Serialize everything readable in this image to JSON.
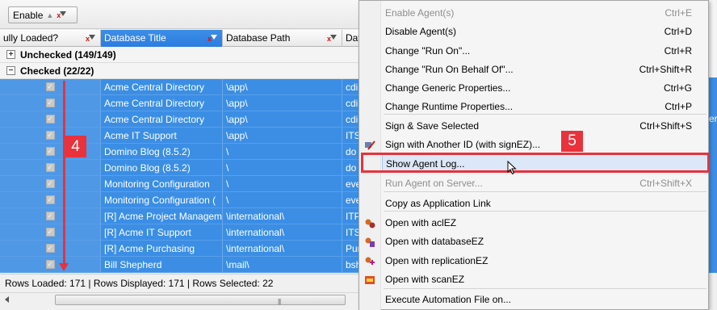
{
  "toolbar": {
    "enable_label": "Enable"
  },
  "grid": {
    "columns": [
      "ully Loaded?",
      "Database Title",
      "Database Path",
      "Dat"
    ],
    "groups": [
      {
        "expander": "+",
        "label": "Unchecked (149/149)"
      },
      {
        "expander": "−",
        "label": "Checked (22/22)"
      }
    ],
    "rows": [
      {
        "title": "Acme Central Directory",
        "path": "\\app\\",
        "extra": "cdi"
      },
      {
        "title": "Acme Central Directory",
        "path": "\\app\\",
        "extra": "cdi"
      },
      {
        "title": "Acme Central Directory",
        "path": "\\app\\",
        "extra": "cdi"
      },
      {
        "title": "Acme IT Support",
        "path": "\\app\\",
        "extra": "ITS"
      },
      {
        "title": "Domino Blog (8.5.2)",
        "path": "\\",
        "extra": "do"
      },
      {
        "title": "Domino Blog (8.5.2)",
        "path": "\\",
        "extra": "do"
      },
      {
        "title": "Monitoring Configuration",
        "path": "\\",
        "extra": "eve"
      },
      {
        "title": "Monitoring Configuration (",
        "path": "\\",
        "extra": "eve"
      },
      {
        "title": "[R] Acme Project Managem",
        "path": "\\international\\",
        "extra": "ITP"
      },
      {
        "title": "[R] Acme IT Support",
        "path": "\\international\\",
        "extra": "ITS"
      },
      {
        "title": "[R] Acme Purchasing",
        "path": "\\international\\",
        "extra": "Pur"
      },
      {
        "title": "Bill Shepherd",
        "path": "\\mail\\",
        "extra": "bsh"
      }
    ],
    "status": "Rows Loaded: 171  |  Rows Displayed: 171  |  Rows Selected: 22"
  },
  "background_partial": {
    "text": "er"
  },
  "annotations": {
    "step4": "4",
    "step5": "5"
  },
  "menu": {
    "items": [
      {
        "label": "Enable Agent(s)",
        "shortcut": "Ctrl+E",
        "disabled": true
      },
      {
        "label": "Disable Agent(s)",
        "shortcut": "Ctrl+D"
      },
      {
        "label": "Change \"Run On\"...",
        "shortcut": "Ctrl+R"
      },
      {
        "label": "Change \"Run On Behalf Of\"...",
        "shortcut": "Ctrl+Shift+R"
      },
      {
        "label": "Change Generic Properties...",
        "shortcut": "Ctrl+G"
      },
      {
        "label": "Change Runtime Properties...",
        "shortcut": "Ctrl+P"
      },
      {
        "label": "Sign & Save Selected",
        "shortcut": "Ctrl+Shift+S"
      },
      {
        "label": "Sign with Another ID (with signEZ)...",
        "shortcut": "",
        "icon": "signez-icon"
      },
      {
        "label": "Show Agent Log...",
        "shortcut": "",
        "highlighted": true
      },
      {
        "label": "Run Agent on Server...",
        "shortcut": "Ctrl+Shift+X",
        "disabled": true
      },
      {
        "label": "Copy as Application Link",
        "shortcut": ""
      },
      {
        "label": "Open with aclEZ",
        "shortcut": "",
        "icon": "aclez-icon"
      },
      {
        "label": "Open with databaseEZ",
        "shortcut": "",
        "icon": "databaseez-icon"
      },
      {
        "label": "Open with replicationEZ",
        "shortcut": "",
        "icon": "replicationez-icon"
      },
      {
        "label": "Open with scanEZ",
        "shortcut": "",
        "icon": "scanez-icon"
      },
      {
        "label": "Execute Automation File on...",
        "shortcut": ""
      }
    ]
  },
  "colors": {
    "selection": "#3b8ee4",
    "annotation": "#e8323c",
    "menu_highlight": "#dce8f7"
  }
}
